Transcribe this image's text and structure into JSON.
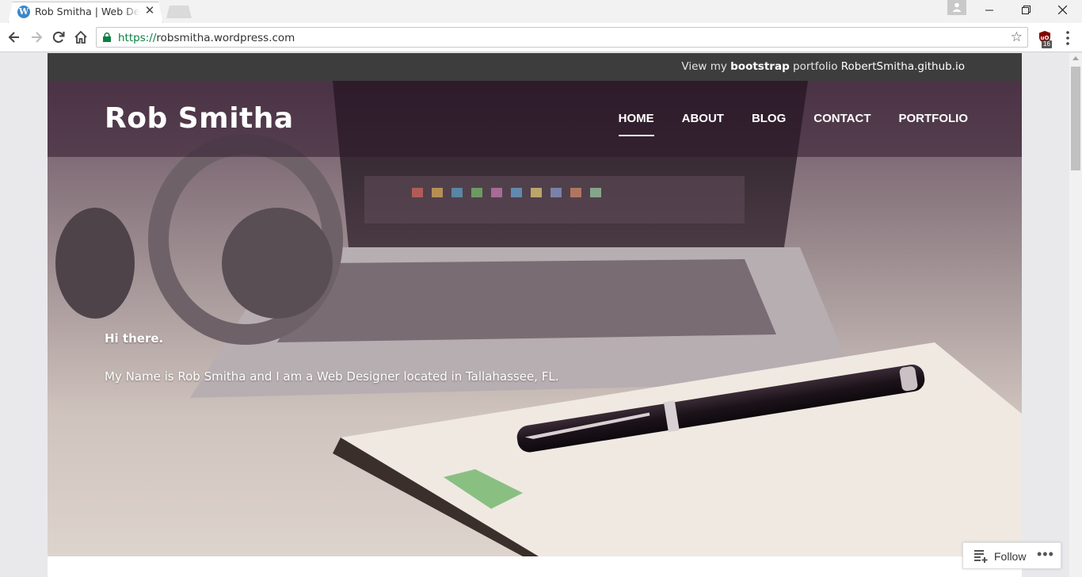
{
  "browser": {
    "tab_title": "Rob Smitha | Web Designer",
    "favicon_letter": "W",
    "url_scheme": "https://",
    "url_host": "robsmitha.wordpress.com",
    "extension_badge": "16"
  },
  "site": {
    "topbar_prefix": "View my ",
    "topbar_bold": "bootstrap",
    "topbar_middle": " portfolio ",
    "topbar_link": "RobertSmitha.github.io",
    "title": "Rob Smitha",
    "nav": [
      {
        "label": "HOME",
        "active": true
      },
      {
        "label": "ABOUT"
      },
      {
        "label": "BLOG"
      },
      {
        "label": "CONTACT"
      },
      {
        "label": "PORTFOLIO"
      }
    ],
    "greeting": "Hi there.",
    "intro": "My Name is Rob Smitha and I am a Web Designer located in Tallahassee, FL."
  },
  "follow": {
    "label": "Follow",
    "more": "•••"
  },
  "colors": {
    "topbar_bg": "#3d3d3d",
    "header_overlay": "#32192d",
    "secure_green": "#0b8043"
  }
}
